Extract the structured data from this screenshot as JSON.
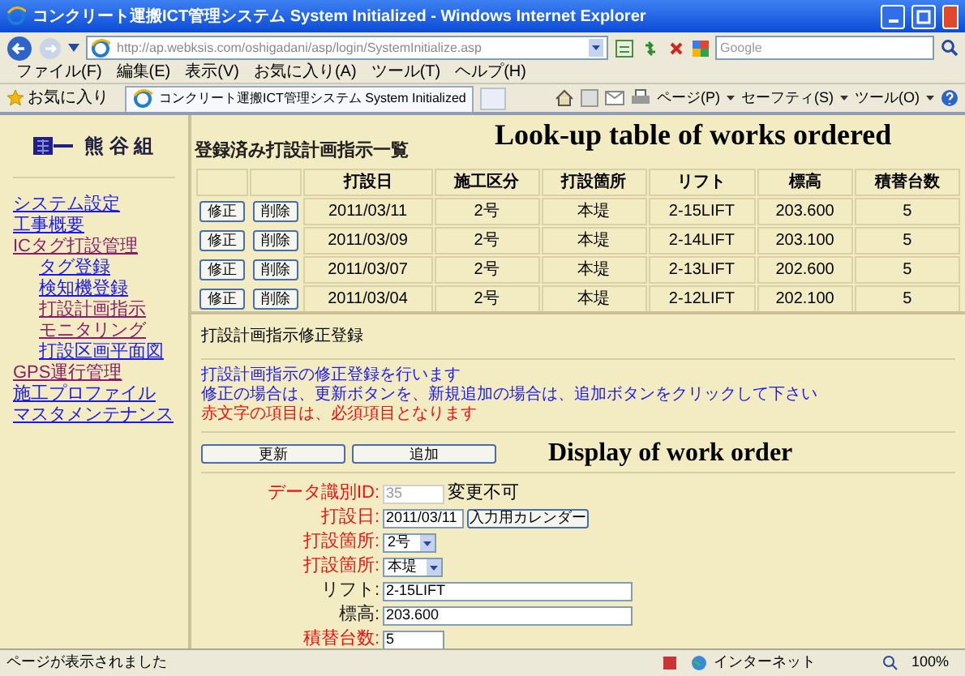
{
  "window": {
    "title": "コンクリート運搬ICT管理システム System Initialized - Windows Internet Explorer"
  },
  "address_bar": {
    "url": "http://ap.webksis.com/oshigadani/asp/login/SystemInitialize.asp",
    "search_placeholder": "Google"
  },
  "menu": [
    "ファイル(F)",
    "編集(E)",
    "表示(V)",
    "お気に入り(A)",
    "ツール(T)",
    "ヘルプ(H)"
  ],
  "favorites_bar": {
    "favorites": "お気に入り",
    "tab": "コンクリート運搬ICT管理システム System Initialized",
    "tools": [
      "ページ(P)",
      "セーフティ(S)",
      "ツール(O)"
    ]
  },
  "sidebar": {
    "logo": "熊 谷 組",
    "items": [
      {
        "label": "システム設定",
        "visited": false
      },
      {
        "label": "工事概要",
        "visited": false
      },
      {
        "label": "ICタグ打設管理",
        "visited": true,
        "children": [
          {
            "label": "タグ登録",
            "visited": false
          },
          {
            "label": "検知機登録",
            "visited": false
          },
          {
            "label": "打設計画指示",
            "visited": true
          },
          {
            "label": "モニタリング",
            "visited": true
          },
          {
            "label": "打設区画平面図",
            "visited": false
          }
        ]
      },
      {
        "label": "GPS運行管理",
        "visited": true
      },
      {
        "label": "施工プロファイル",
        "visited": false
      },
      {
        "label": "マスタメンテナンス",
        "visited": false
      }
    ]
  },
  "list": {
    "heading": "登録済み打設計画指示一覧",
    "columns": [
      "打設日",
      "施工区分",
      "打設箇所",
      "リフト",
      "標高",
      "積替台数"
    ],
    "rows": [
      {
        "edit": "修正",
        "delete": "削除",
        "cells": [
          "2011/03/11",
          "2号",
          "本堤",
          "2-15LIFT",
          "203.600",
          "5"
        ]
      },
      {
        "edit": "修正",
        "delete": "削除",
        "cells": [
          "2011/03/09",
          "2号",
          "本堤",
          "2-14LIFT",
          "203.100",
          "5"
        ]
      },
      {
        "edit": "修正",
        "delete": "削除",
        "cells": [
          "2011/03/07",
          "2号",
          "本堤",
          "2-13LIFT",
          "202.600",
          "5"
        ]
      },
      {
        "edit": "修正",
        "delete": "削除",
        "cells": [
          "2011/03/04",
          "2号",
          "本堤",
          "2-12LIFT",
          "202.100",
          "5"
        ]
      }
    ]
  },
  "form": {
    "heading": "打設計画指示修正登録",
    "notes": [
      {
        "kind": "info",
        "text": "打設計画指示の修正登録を行います"
      },
      {
        "kind": "info",
        "text": "修正の場合は、更新ボタンを、新規追加の場合は、追加ボタンをクリックして下さい"
      },
      {
        "kind": "required",
        "text": "赤文字の項目は、必須項目となります"
      }
    ],
    "buttons": [
      "更新",
      "追加"
    ],
    "fields": [
      {
        "label": "データ識別ID:",
        "required": true,
        "kind": "readonly",
        "value": "35",
        "note": "変更不可"
      },
      {
        "label": "打設日:",
        "required": true,
        "kind": "date",
        "value": "2011/03/11",
        "button": "入力用カレンダー"
      },
      {
        "label": "打設箇所:",
        "required": true,
        "kind": "select",
        "value": "2号"
      },
      {
        "label": "打設箇所:",
        "required": true,
        "kind": "select",
        "value": "本堤"
      },
      {
        "label": "リフト:",
        "required": false,
        "kind": "text",
        "value": "2-15LIFT"
      },
      {
        "label": "標高:",
        "required": false,
        "kind": "text",
        "value": "203.600"
      },
      {
        "label": "積替台数:",
        "required": true,
        "kind": "short",
        "value": "5"
      }
    ]
  },
  "annotations": [
    "Look-up table of works ordered",
    "Display of work order"
  ],
  "status_bar": {
    "message": "ページが表示されました",
    "zone": "インターネット",
    "zoom": "100%"
  }
}
